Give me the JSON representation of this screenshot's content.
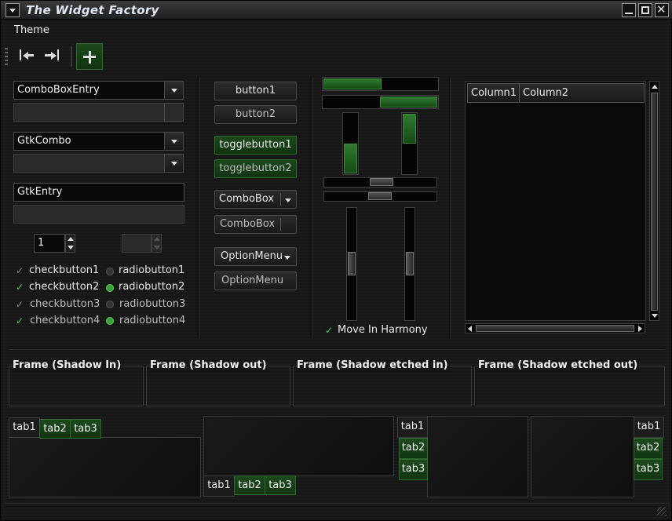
{
  "window": {
    "title": "The Widget Factory"
  },
  "menubar": {
    "theme": "Theme"
  },
  "toolbar": {
    "prev_icon": "go-first-icon",
    "next_icon": "go-last-icon",
    "add_icon": "add-icon"
  },
  "left": {
    "combo_entry": "ComboBoxEntry",
    "combo_entry2": "",
    "gtkcombo": "GtkCombo",
    "gtkcombo2": "",
    "gtkentry": "GtkEntry",
    "gtkentry2": "",
    "spin1": "1",
    "spin2": "",
    "checks": [
      "checkbutton1",
      "checkbutton2",
      "checkbutton3",
      "checkbutton4"
    ],
    "radios": [
      "radiobutton1",
      "radiobutton2",
      "radiobutton3",
      "radiobutton4"
    ]
  },
  "buttons": {
    "button1": "button1",
    "button2": "button2",
    "toggle1": "togglebutton1",
    "toggle2": "togglebutton2",
    "combobox1": "ComboBox",
    "combobox2": "ComboBox",
    "option1": "OptionMenu",
    "option2": "OptionMenu"
  },
  "sliders": {
    "harmony": "Move In Harmony"
  },
  "tree": {
    "columns": [
      "Column1",
      "Column2"
    ]
  },
  "frames": [
    "Frame (Shadow In)",
    "Frame (Shadow out)",
    "Frame (Shadow etched in)",
    "Frame (Shadow etched out)"
  ],
  "tabs": {
    "nb1": [
      "tab1",
      "tab2",
      "tab3"
    ],
    "nb2": [
      "tab1",
      "tab2",
      "tab3"
    ],
    "nb3": [
      "tab1",
      "tab2",
      "tab3"
    ],
    "nb4": [
      "tab1",
      "tab2",
      "tab3"
    ]
  },
  "colors": {
    "accent": "#2f7a2f",
    "window_bg": "#161616",
    "title_text": "#dfe8f5"
  }
}
